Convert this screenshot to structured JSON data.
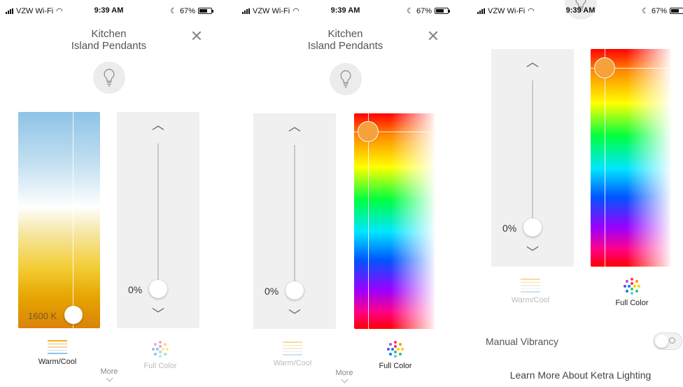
{
  "status": {
    "carrier": "VZW Wi-Fi",
    "time": "9:39 AM",
    "battery": "67%",
    "battery_level": 0.67
  },
  "header": {
    "title": "Kitchen",
    "subtitle": "Island Pendants",
    "close_label": "✕"
  },
  "brightness": {
    "value_label": "0%",
    "level": 0
  },
  "warm_cool": {
    "kelvin_label": "1600 K"
  },
  "tabs": {
    "warm_cool_label": "Warm/Cool",
    "full_color_label": "Full Color",
    "more_label": "More"
  },
  "settings": {
    "manual_vibrancy_label": "Manual Vibrancy",
    "manual_vibrancy_on": false,
    "learn_more_label": "Learn More About Ketra Lighting"
  },
  "icons": {
    "bulb": "lightbulb-icon",
    "close": "close-icon",
    "chevron_up": "chevron-up-icon",
    "chevron_down": "chevron-down-icon",
    "warm_cool": "warm-cool-lines-icon",
    "full_color": "color-dots-icon"
  },
  "colors": {
    "accent_knob": "#f7a13b",
    "warm_top": "#8ec3e6",
    "warm_bottom": "#d9830a"
  }
}
